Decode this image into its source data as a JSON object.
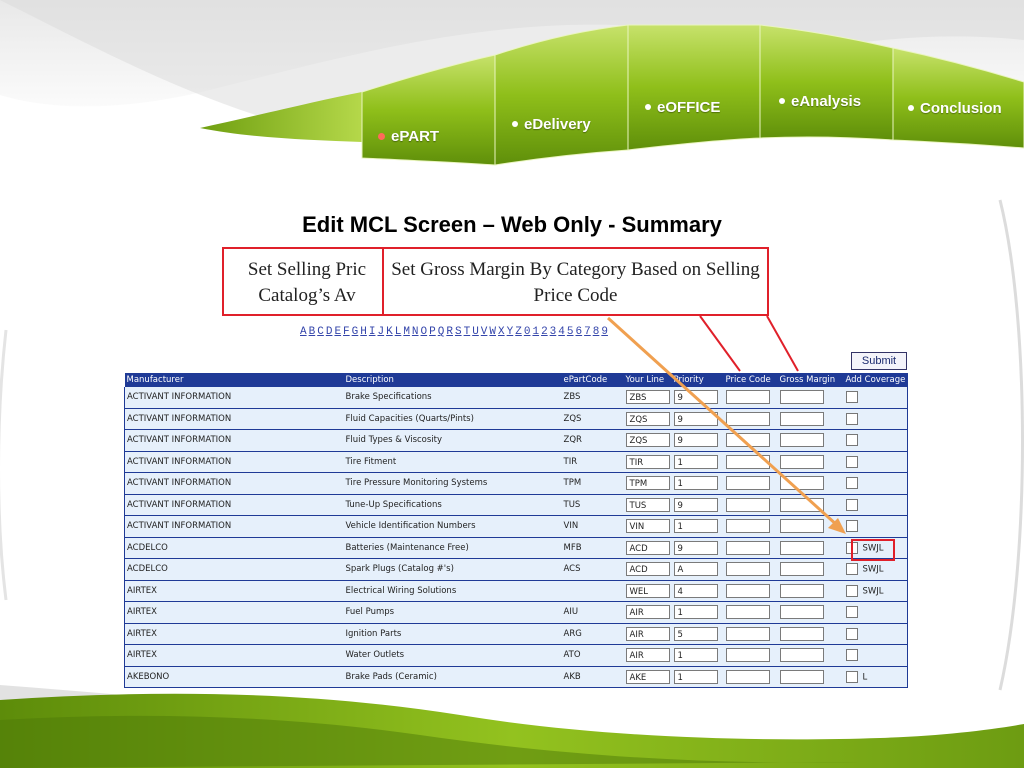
{
  "nav": {
    "tabs": [
      {
        "label": "ePART",
        "active": true
      },
      {
        "label": "eDelivery",
        "active": false
      },
      {
        "label": "eOFFICE",
        "active": false
      },
      {
        "label": "eAnalysis",
        "active": false
      },
      {
        "label": "Conclusion",
        "active": false
      }
    ]
  },
  "slide": {
    "title": "Edit MCL Screen – Web Only - Summary",
    "callout_selling": "Set Selling Pric\nCatalog’s Av",
    "callout_margin": "Set Gross Margin By Category Based on Selling Price Code"
  },
  "alpha_links": [
    "A",
    "B",
    "C",
    "D",
    "E",
    "F",
    "G",
    "H",
    "I",
    "J",
    "K",
    "L",
    "M",
    "N",
    "O",
    "P",
    "Q",
    "R",
    "S",
    "T",
    "U",
    "V",
    "W",
    "X",
    "Y",
    "Z",
    "0",
    "1",
    "2",
    "3",
    "4",
    "5",
    "6",
    "7",
    "8",
    "9"
  ],
  "submit_label": "Submit",
  "table": {
    "headers": [
      "Manufacturer",
      "Description",
      "ePartCode",
      "Your Line",
      "Priority",
      "Price Code",
      "Gross Margin",
      "Add Coverage"
    ],
    "rows": [
      {
        "mfr": "ACTIVANT INFORMATION",
        "desc": "Brake Specifications",
        "code": "ZBS",
        "line": "ZBS",
        "pri": "9",
        "cov": ""
      },
      {
        "mfr": "ACTIVANT INFORMATION",
        "desc": "Fluid Capacities (Quarts/Pints)",
        "code": "ZQS",
        "line": "ZQS",
        "pri": "9",
        "cov": ""
      },
      {
        "mfr": "ACTIVANT INFORMATION",
        "desc": "Fluid Types & Viscosity",
        "code": "ZQR",
        "line": "ZQS",
        "pri": "9",
        "cov": ""
      },
      {
        "mfr": "ACTIVANT INFORMATION",
        "desc": "Tire Fitment",
        "code": "TIR",
        "line": "TIR",
        "pri": "1",
        "cov": ""
      },
      {
        "mfr": "ACTIVANT INFORMATION",
        "desc": "Tire Pressure Monitoring Systems",
        "code": "TPM",
        "line": "TPM",
        "pri": "1",
        "cov": ""
      },
      {
        "mfr": "ACTIVANT INFORMATION",
        "desc": "Tune-Up Specifications",
        "code": "TUS",
        "line": "TUS",
        "pri": "9",
        "cov": ""
      },
      {
        "mfr": "ACTIVANT INFORMATION",
        "desc": "Vehicle Identification Numbers",
        "code": "VIN",
        "line": "VIN",
        "pri": "1",
        "cov": ""
      },
      {
        "mfr": "ACDELCO",
        "desc": "Batteries (Maintenance Free)",
        "code": "MFB",
        "line": "ACD",
        "pri": "9",
        "cov": "SWJL"
      },
      {
        "mfr": "ACDELCO",
        "desc": "Spark Plugs (Catalog #'s)",
        "code": "ACS",
        "line": "ACD",
        "pri": "A",
        "cov": "SWJL"
      },
      {
        "mfr": "AIRTEX",
        "desc": "Electrical Wiring Solutions",
        "code": "",
        "line": "WEL",
        "pri": "4",
        "cov": "SWJL"
      },
      {
        "mfr": "AIRTEX",
        "desc": "Fuel Pumps",
        "code": "AIU",
        "line": "AIR",
        "pri": "1",
        "cov": ""
      },
      {
        "mfr": "AIRTEX",
        "desc": "Ignition Parts",
        "code": "ARG",
        "line": "AIR",
        "pri": "5",
        "cov": ""
      },
      {
        "mfr": "AIRTEX",
        "desc": "Water Outlets",
        "code": "ATO",
        "line": "AIR",
        "pri": "1",
        "cov": ""
      },
      {
        "mfr": "AKEBONO",
        "desc": "Brake Pads (Ceramic)",
        "code": "AKB",
        "line": "AKE",
        "pri": "1",
        "cov": "L"
      }
    ]
  },
  "colors": {
    "nav_green": "#8fbf1a",
    "header_blue": "#1f3a96",
    "callout_red": "#e0202a",
    "arrow_orange": "#f0a050"
  }
}
